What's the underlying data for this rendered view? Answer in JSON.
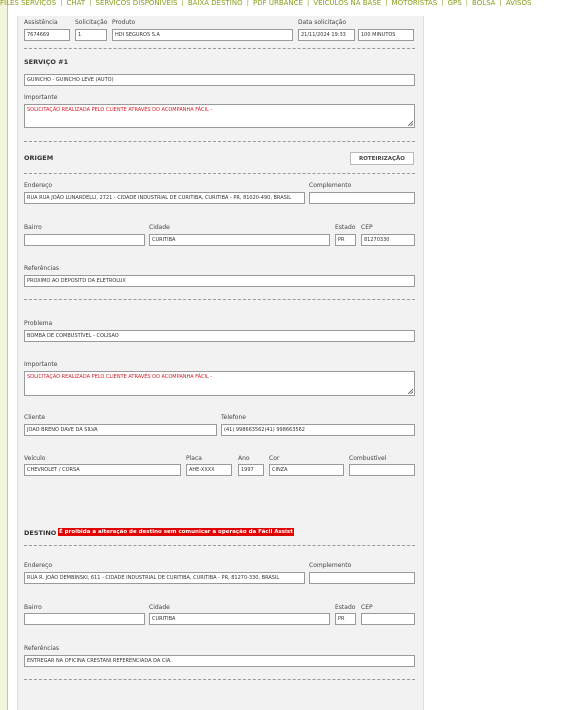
{
  "nav": {
    "items": [
      "FILES SERVIÇOS",
      "CHAT",
      "SERVIÇOS DISPONÍVEIS",
      "BAIXA DESTINO",
      "PDF URBANCE",
      "VEÍCULOS NA BASE",
      "MOTORISTAS",
      "GPS",
      "BOLSA",
      "AVISOS"
    ]
  },
  "header": {
    "assistencia_label": "Assistência",
    "assistencia_value": "7674669",
    "solicitacao_label": "Solicitação",
    "solicitacao_value": "1",
    "produto_label": "Produto",
    "produto_value": "HDI SEGUROS S.A",
    "data_label": "Data solicitação",
    "data_value": "21/11/2024 19:33",
    "tempo_value": "100 MINUTOS"
  },
  "servico": {
    "title": "SERVIÇO #1",
    "tipo_value": "GUINCHO - GUINCHO LEVE (AUTO)",
    "importante_label": "Importante",
    "importante_value": "SOLICITAÇÃO REALIZADA PELO CLIENTE ATRAVÉS DO ACOMPANHA FÁCIL -"
  },
  "origem": {
    "title": "ORIGEM",
    "roteirizacao_button": "ROTEIRIZAÇÃO",
    "endereco_label": "Endereço",
    "endereco_value": "RUA RUA JOÃO LUNARDELLI, 2721 - CIDADE INDUSTRIAL DE CURITIBA, CURITIBA - PR, 81020-490, BRASIL",
    "complemento_label": "Complemento",
    "complemento_value": "",
    "bairro_label": "Bairro",
    "bairro_value": "",
    "cidade_label": "Cidade",
    "cidade_value": "CURITIBA",
    "estado_label": "Estado",
    "estado_value": "PR",
    "cep_label": "CEP",
    "cep_value": "81270330",
    "referencias_label": "Referências",
    "referencias_value": "PROXIMO AO DEPOSITO DA ELETROLUX"
  },
  "problema": {
    "label": "Problema",
    "value": "BOMBA DE COMBUSTÍVEL - COLISAO",
    "importante_label": "Importante",
    "importante_value": "SOLICITAÇÃO REALIZADA PELO CLIENTE ATRAVÉS DO ACOMPANHA FÁCIL -"
  },
  "cliente": {
    "cliente_label": "Cliente",
    "cliente_value": "JOAO BRENO DAVE DA SILVA",
    "telefone_label": "Telefone",
    "telefone_value": "(41) 998663562(41) 998663562"
  },
  "veiculo": {
    "veiculo_label": "Veículo",
    "veiculo_value": "CHEVROLET / CORSA",
    "placa_label": "Placa",
    "placa_value": "AHE-XXXX",
    "ano_label": "Ano",
    "ano_value": "1997",
    "cor_label": "Cor",
    "cor_value": "CINZA",
    "combustivel_label": "Combustível",
    "combustivel_value": ""
  },
  "destino": {
    "title": "DESTINO",
    "warning": "É proibida a alteração de destino sem comunicar a operação da Fácil Assist",
    "endereco_label": "Endereço",
    "endereco_value": "RUA R. JOÃO DEMBINSKI, 611 - CIDADE INDUSTRIAL DE CURITIBA, CURITIBA - PR, 81270-330, BRASIL",
    "complemento_label": "Complemento",
    "complemento_value": "",
    "bairro_label": "Bairro",
    "bairro_value": "",
    "cidade_label": "Cidade",
    "cidade_value": "CURITIBA",
    "estado_label": "Estado",
    "estado_value": "PR",
    "cep_label": "CEP",
    "cep_value": "",
    "referencias_label": "Referências",
    "referencias_value": "ENTREGAR NA OFICINA CRESTANI REFERENCIADA DA CIA."
  },
  "colors": {
    "nav_text": "#8a9a1a",
    "warning_bg": "#e00000",
    "important_text": "#d0202a",
    "panel_bg": "#f2f2f2"
  }
}
